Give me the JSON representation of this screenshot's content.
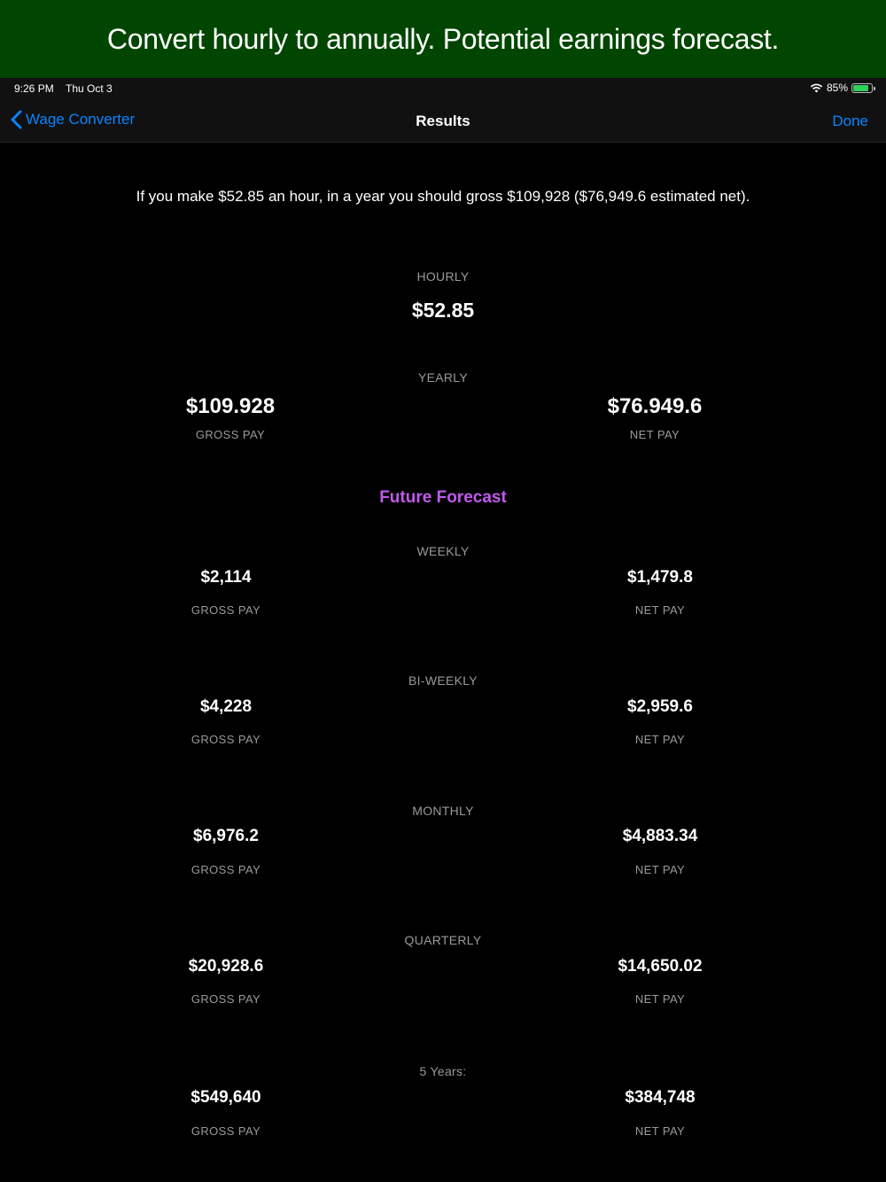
{
  "banner": {
    "text": "Convert hourly to annually. Potential earnings forecast."
  },
  "status": {
    "time": "9:26 PM",
    "date": "Thu Oct 3",
    "battery": "85%",
    "battery_level": 0.85
  },
  "nav": {
    "back_label": "Wage Converter",
    "title": "Results",
    "done_label": "Done"
  },
  "summary": "If you make $52.85 an hour, in a year you should gross $109,928 ($76,949.6 estimated net).",
  "hourly": {
    "label": "HOURLY",
    "value": "$52.85"
  },
  "yearly": {
    "label": "YEARLY",
    "gross": "$109.928",
    "gross_label": "GROSS PAY",
    "net": "$76.949.6",
    "net_label": "NET PAY"
  },
  "forecast_title": "Future Forecast",
  "forecast": [
    {
      "period": "WEEKLY",
      "gross": "$2,114",
      "net": "$1,479.8",
      "gross_label": "GROSS PAY",
      "net_label": "NET PAY"
    },
    {
      "period": "BI-WEEKLY",
      "gross": "$4,228",
      "net": "$2,959.6",
      "gross_label": "GROSS PAY",
      "net_label": "NET PAY"
    },
    {
      "period": "MONTHLY",
      "gross": "$6,976.2",
      "net": "$4,883.34",
      "gross_label": "GROSS PAY",
      "net_label": "NET PAY"
    },
    {
      "period": "QUARTERLY",
      "gross": "$20,928.6",
      "net": "$14,650.02",
      "gross_label": "GROSS PAY",
      "net_label": "NET PAY"
    },
    {
      "period": "5 Years:",
      "gross": "$549,640",
      "net": "$384,748",
      "gross_label": "GROSS PAY",
      "net_label": "NET PAY"
    }
  ]
}
